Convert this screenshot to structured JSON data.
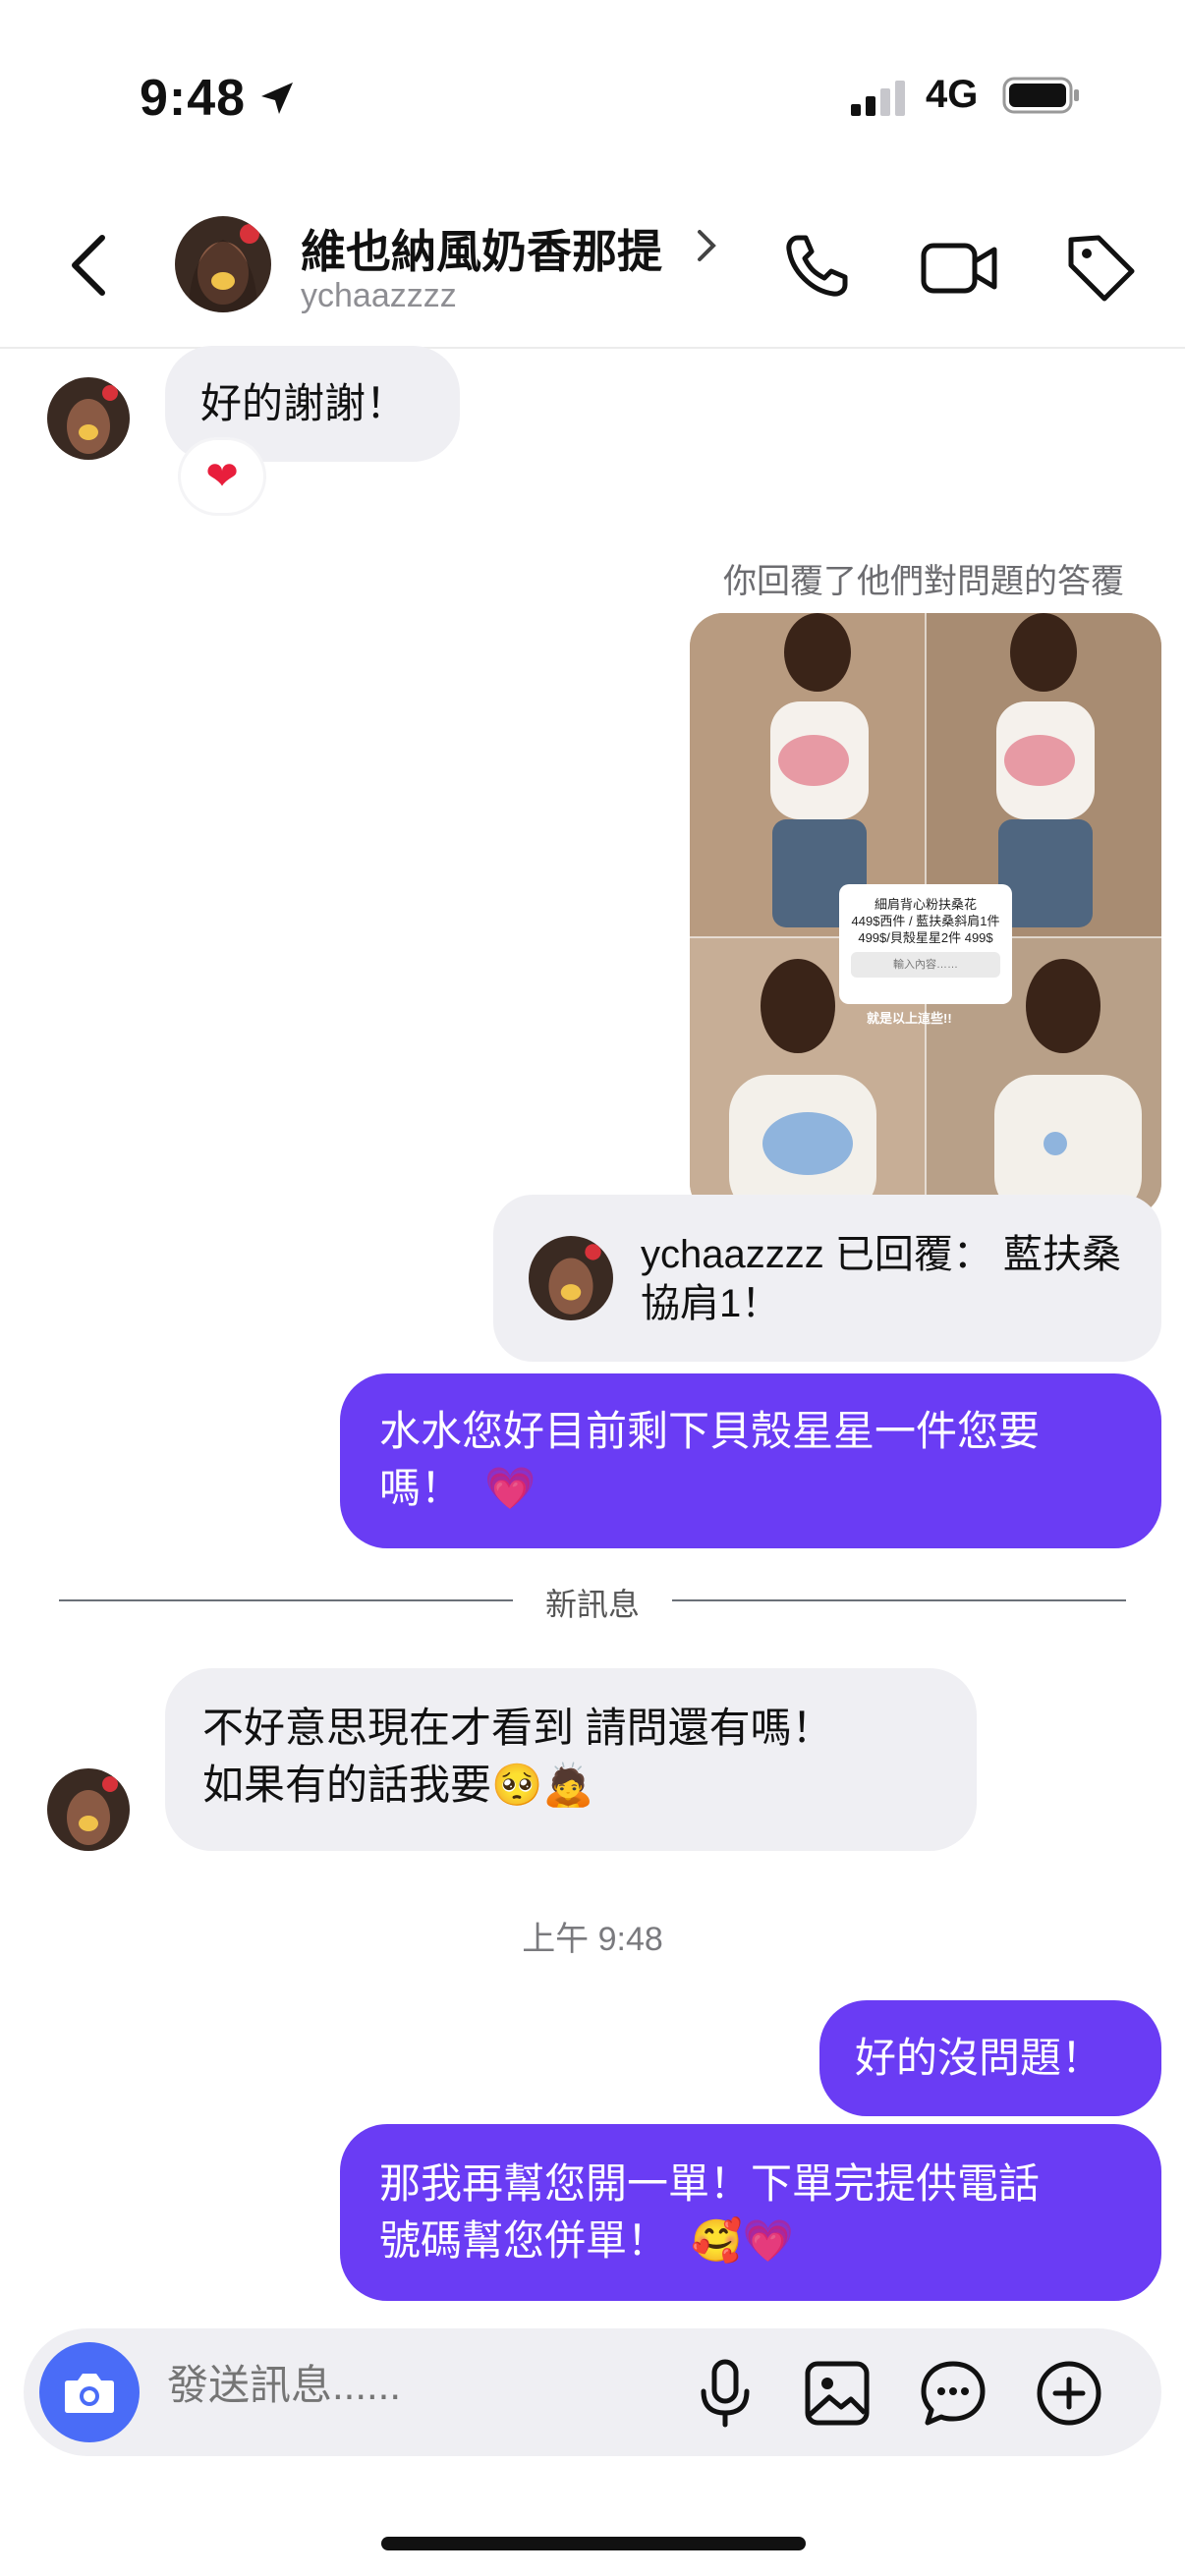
{
  "status_bar": {
    "time": "9:48",
    "network": "4G"
  },
  "header": {
    "name": "維也納風奶香那提",
    "username": "ychaazzzz"
  },
  "messages": {
    "m1": {
      "text": "好的謝謝！",
      "reaction": "❤"
    },
    "reply_note": "你回覆了他們對問題的答覆",
    "story": {
      "overlay_line1": "細肩背心粉扶桑花",
      "overlay_line2": "449$西件 / 藍扶桑斜肩1件",
      "overlay_line3": "499$/貝殼星星2件 499$",
      "overlay_input": "輸入內容……",
      "caption": "就是以上這些!!"
    },
    "quoted_reply": {
      "text": "ychaazzzz 已回覆： 藍扶桑協肩1！"
    },
    "m2": {
      "line1": "水水您好目前剩下貝殼星星一件您要",
      "line2": "嗎！",
      "emoji": "💗"
    },
    "divider": "新訊息",
    "m3": {
      "line1": "不好意思現在才看到 請問還有嗎！",
      "line2": "如果有的話我要",
      "emoji": "🥺🙇"
    },
    "timestamp": "上午 9:48",
    "m4": {
      "text": "好的沒問題！"
    },
    "m5": {
      "line1": "那我再幫您開一單！下單完提供電話",
      "line2": "號碼幫您併單！",
      "emoji": "🥰💗"
    }
  },
  "composer": {
    "placeholder": "發送訊息......"
  },
  "colors": {
    "outgoing": "#6a3cf4",
    "incoming": "#efeff3",
    "camera": "#4a6cf7"
  }
}
